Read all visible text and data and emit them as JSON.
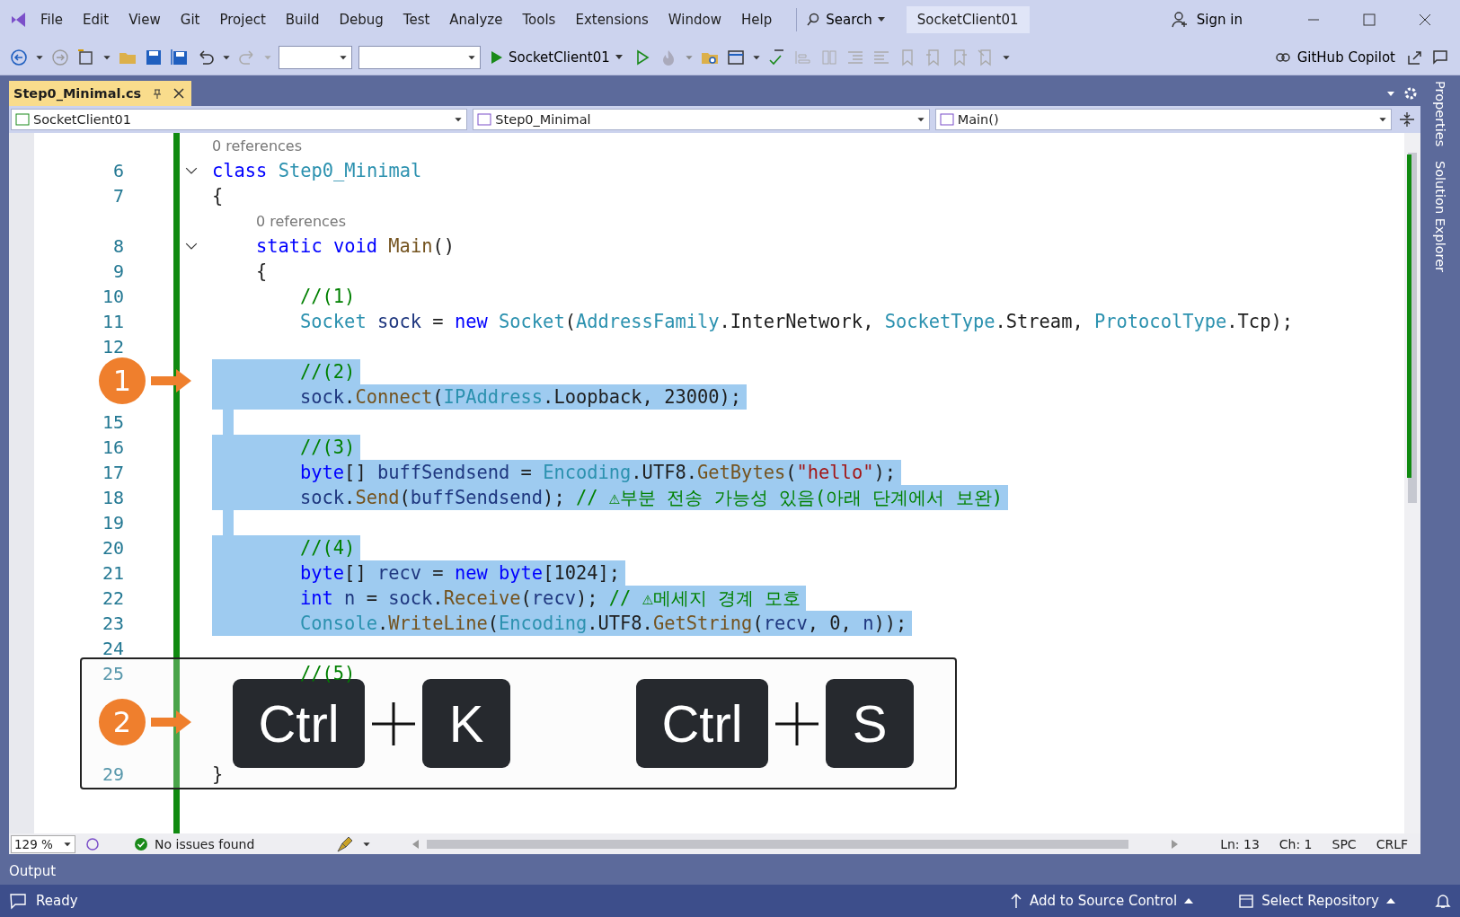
{
  "menu": [
    "File",
    "Edit",
    "View",
    "Git",
    "Project",
    "Build",
    "Debug",
    "Test",
    "Analyze",
    "Tools",
    "Extensions",
    "Window",
    "Help"
  ],
  "search": {
    "label": "Search"
  },
  "solution_name": "SocketClient01",
  "sign_in": "Sign in",
  "toolbar": {
    "run_target": "SocketClient01",
    "copilot": "GitHub Copilot"
  },
  "document_tabs": [
    {
      "label": "Step0_Minimal.cs",
      "selected": true
    }
  ],
  "nav_bar": [
    "SocketClient01",
    "Step0_Minimal",
    "Main()"
  ],
  "side_panels": [
    "Properties",
    "Solution Explorer"
  ],
  "code_lines": [
    {
      "kind": "lens",
      "text": "0 references"
    },
    {
      "kind": "code",
      "number": "6",
      "fold": true,
      "selected": false,
      "tokens": [
        {
          "kind": "keyword",
          "text": "class "
        },
        {
          "kind": "type",
          "text": "Step0_Minimal"
        }
      ]
    },
    {
      "kind": "code",
      "number": "7",
      "fold": false,
      "selected": false,
      "tokens": [
        {
          "kind": "plain",
          "text": "{"
        }
      ]
    },
    {
      "kind": "member_lens",
      "text": "0 references"
    },
    {
      "kind": "member_code",
      "number": "8",
      "fold": true,
      "selected": false,
      "tokens": [
        {
          "kind": "keyword",
          "text": "static void "
        },
        {
          "kind": "method",
          "text": "Main"
        },
        {
          "kind": "plain",
          "text": "()"
        }
      ]
    },
    {
      "kind": "member_code",
      "number": "9",
      "fold": false,
      "selected": false,
      "tokens": [
        {
          "kind": "plain",
          "text": "{"
        }
      ]
    },
    {
      "kind": "body_code",
      "number": "10",
      "fold": false,
      "selected": false,
      "tokens": [
        {
          "kind": "comment",
          "text": "//(1)"
        }
      ]
    },
    {
      "kind": "body_code",
      "number": "11",
      "fold": false,
      "selected": false,
      "tokens": [
        {
          "kind": "type",
          "text": "Socket "
        },
        {
          "kind": "local",
          "text": "sock"
        },
        {
          "kind": "plain",
          "text": " = "
        },
        {
          "kind": "keyword",
          "text": "new "
        },
        {
          "kind": "type",
          "text": "Socket"
        },
        {
          "kind": "plain",
          "text": "("
        },
        {
          "kind": "type",
          "text": "AddressFamily"
        },
        {
          "kind": "plain",
          "text": ".InterNetwork, "
        },
        {
          "kind": "type",
          "text": "SocketType"
        },
        {
          "kind": "plain",
          "text": ".Stream, "
        },
        {
          "kind": "type",
          "text": "ProtocolType"
        },
        {
          "kind": "plain",
          "text": ".Tcp);"
        }
      ]
    },
    {
      "kind": "body_code",
      "number": "12",
      "fold": false,
      "selected": false
    },
    {
      "kind": "body_code",
      "fold": false,
      "selected": true,
      "tokens": [
        {
          "kind": "comment",
          "text": "//(2)"
        }
      ]
    },
    {
      "kind": "body_code",
      "fold": false,
      "selected": true,
      "tokens": [
        {
          "kind": "local",
          "text": "sock"
        },
        {
          "kind": "plain",
          "text": "."
        },
        {
          "kind": "method",
          "text": "Connect"
        },
        {
          "kind": "plain",
          "text": "("
        },
        {
          "kind": "type",
          "text": "IPAddress"
        },
        {
          "kind": "plain",
          "text": ".Loopback, 23000);"
        }
      ]
    },
    {
      "kind": "body_code",
      "number": "15",
      "fold": false,
      "selected": true
    },
    {
      "kind": "body_code",
      "number": "16",
      "fold": false,
      "selected": true,
      "tokens": [
        {
          "kind": "comment",
          "text": "//(3)"
        }
      ]
    },
    {
      "kind": "body_code",
      "number": "17",
      "fold": false,
      "selected": true,
      "tokens": [
        {
          "kind": "keyword",
          "text": "byte"
        },
        {
          "kind": "plain",
          "text": "[] "
        },
        {
          "kind": "local",
          "text": "buffSendsend"
        },
        {
          "kind": "plain",
          "text": " = "
        },
        {
          "kind": "type",
          "text": "Encoding"
        },
        {
          "kind": "plain",
          "text": ".UTF8."
        },
        {
          "kind": "method",
          "text": "GetBytes"
        },
        {
          "kind": "plain",
          "text": "("
        },
        {
          "kind": "string",
          "text": "\"hello\""
        },
        {
          "kind": "plain",
          "text": ");"
        }
      ]
    },
    {
      "kind": "body_code",
      "number": "18",
      "fold": false,
      "selected": true,
      "tokens": [
        {
          "kind": "local",
          "text": "sock"
        },
        {
          "kind": "plain",
          "text": "."
        },
        {
          "kind": "method",
          "text": "Send"
        },
        {
          "kind": "plain",
          "text": "("
        },
        {
          "kind": "local",
          "text": "buffSendsend"
        },
        {
          "kind": "plain",
          "text": "); "
        },
        {
          "kind": "comment",
          "text": "// ⚠부분 전송 가능성 있음(아래 단계에서 보완)"
        }
      ]
    },
    {
      "kind": "body_code",
      "number": "19",
      "fold": false,
      "selected": true
    },
    {
      "kind": "body_code",
      "number": "20",
      "fold": false,
      "selected": true,
      "tokens": [
        {
          "kind": "comment",
          "text": "//(4)"
        }
      ]
    },
    {
      "kind": "body_code",
      "number": "21",
      "fold": false,
      "selected": true,
      "tokens": [
        {
          "kind": "keyword",
          "text": "byte"
        },
        {
          "kind": "plain",
          "text": "[] "
        },
        {
          "kind": "local",
          "text": "recv"
        },
        {
          "kind": "plain",
          "text": " = "
        },
        {
          "kind": "keyword",
          "text": "new byte"
        },
        {
          "kind": "plain",
          "text": "[1024];"
        }
      ]
    },
    {
      "kind": "body_code",
      "number": "22",
      "fold": false,
      "selected": true,
      "tokens": [
        {
          "kind": "keyword",
          "text": "int "
        },
        {
          "kind": "local",
          "text": "n"
        },
        {
          "kind": "plain",
          "text": " = "
        },
        {
          "kind": "local",
          "text": "sock"
        },
        {
          "kind": "plain",
          "text": "."
        },
        {
          "kind": "method",
          "text": "Receive"
        },
        {
          "kind": "plain",
          "text": "("
        },
        {
          "kind": "local",
          "text": "recv"
        },
        {
          "kind": "plain",
          "text": "); "
        },
        {
          "kind": "comment",
          "text": "// ⚠메세지 경계 모호"
        }
      ]
    },
    {
      "kind": "body_code",
      "number": "23",
      "fold": false,
      "selected": true,
      "tokens": [
        {
          "kind": "type",
          "text": "Console"
        },
        {
          "kind": "plain",
          "text": "."
        },
        {
          "kind": "method",
          "text": "WriteLine"
        },
        {
          "kind": "plain",
          "text": "("
        },
        {
          "kind": "type",
          "text": "Encoding"
        },
        {
          "kind": "plain",
          "text": ".UTF8."
        },
        {
          "kind": "method",
          "text": "GetString"
        },
        {
          "kind": "plain",
          "text": "("
        },
        {
          "kind": "local",
          "text": "recv"
        },
        {
          "kind": "plain",
          "text": ", 0, "
        },
        {
          "kind": "local",
          "text": "n"
        },
        {
          "kind": "plain",
          "text": "));"
        }
      ]
    },
    {
      "kind": "body_code",
      "number": "24",
      "fold": false,
      "selected": false
    },
    {
      "kind": "body_code",
      "number": "25",
      "fold": false,
      "selected": false,
      "tokens": [
        {
          "kind": "comment",
          "text": "//(5)"
        }
      ]
    },
    {
      "kind": "body_code",
      "fold": false,
      "selected": false
    },
    {
      "kind": "body_code",
      "fold": false,
      "selected": false
    },
    {
      "kind": "body_code",
      "fold": false,
      "selected": false
    },
    {
      "kind": "code",
      "number": "29",
      "fold": false,
      "selected": false,
      "tokens": [
        {
          "kind": "plain",
          "text": "}"
        }
      ]
    }
  ],
  "callouts": [
    {
      "label": "1"
    },
    {
      "label": "2"
    }
  ],
  "shortcut": [
    [
      "Ctrl",
      "K"
    ],
    [
      "Ctrl",
      "S"
    ]
  ],
  "editor_status": {
    "zoom": "129 %",
    "issues": "No issues found",
    "line": "Ln: 13",
    "column": "Ch: 1",
    "whitespace": "SPC",
    "line_ending": "CRLF"
  },
  "output_tab": "Output",
  "status_bar": {
    "state": "Ready",
    "source_control": "Add to Source Control",
    "repository": "Select Repository"
  }
}
